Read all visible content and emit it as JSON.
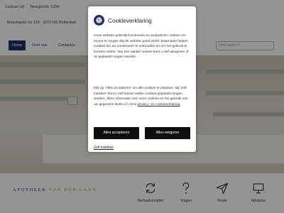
{
  "topbar": {
    "contrast_label": "Contrast",
    "contrast_value": "Uit",
    "textsize_label": "Tekstgrootte",
    "textsize_value": "100%"
  },
  "address": "Maashaven Oz 134 · 3072 HS Rotterdam",
  "nav": {
    "items": [
      "Home",
      "Over ons",
      "Contactus"
    ],
    "search_placeholder": "Wat zoekt u?"
  },
  "footer": {
    "logo_part1": "APOTHEEK",
    "logo_part2": "VAN DER LAAN",
    "quicklinks": [
      {
        "label": "Herhaalrecepten",
        "icon": "refresh-icon"
      },
      {
        "label": "Vragen",
        "icon": "question-icon"
      },
      {
        "label": "Route",
        "icon": "paper-plane-icon"
      },
      {
        "label": "Kijkduiter",
        "icon": "monitor-icon"
      }
    ]
  },
  "cookie_modal": {
    "title": "Cookieverklaring",
    "paragraph1": "Onze website gebruikt functionele en analytische cookies om ervoor te zorgen dat de website goed werkt. Daarnaast helpen cookies om uw voorkeuren te onthouden en om het gebruik te kunnen meten. Van een aantal cookies kunt u zelf aangeven of ze geplaatst mogen worden.",
    "paragraph2_start": "Klik op 'Alles accepteren' om alle cookies te plaatsen. Bij 'Zelf instellen' kunt u zelf kiezen welke cookies geplaatst mogen worden. Meer informatie over onze cookies en het gebruik van uw gegevens leest u in onze ",
    "privacy_link": "privacy- en cookieverklaring",
    "paragraph2_end": ".",
    "accept_label": "Alles accepteren",
    "reject_label": "Alles weigeren",
    "settings_label": "Zelf instellen"
  },
  "colors": {
    "brand_navy": "#232d6b",
    "brand_gold": "#b8962e",
    "button_dark": "#0e0e0e"
  }
}
